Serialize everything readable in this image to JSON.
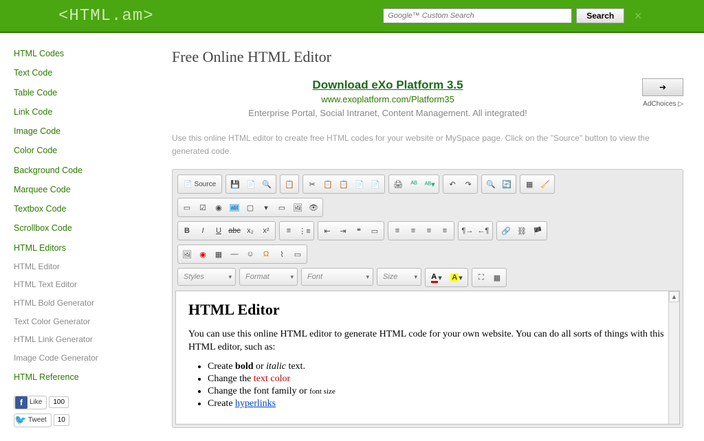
{
  "header": {
    "logo_pre": "<",
    "logo_main": "HTML",
    "logo_suf": ".am>",
    "search_placeholder": "Google™ Custom Search",
    "search_button": "Search"
  },
  "sidebar": {
    "main": [
      "HTML Codes",
      "Text Code",
      "Table Code",
      "Link Code",
      "Image Code",
      "Color Code",
      "Background Code",
      "Marquee Code",
      "Textbox Code",
      "Scrollbox Code",
      "HTML Editors"
    ],
    "sub": [
      "HTML Editor",
      "HTML Text Editor",
      "HTML Bold Generator",
      "Text Color Generator",
      "HTML Link Generator",
      "Image Code Generator"
    ],
    "ref": "HTML Reference",
    "like_label": "Like",
    "like_count": "100",
    "tweet_label": "Tweet",
    "tweet_count": "10"
  },
  "page": {
    "title": "Free Online HTML Editor",
    "ad_title": "Download eXo Platform 3.5",
    "ad_url": "www.exoplatform.com/Platform35",
    "ad_desc": "Enterprise Portal, Social Intranet, Content Management. All integrated!",
    "adchoices": "AdChoices",
    "intro": "Use this online HTML editor to create free HTML codes for your website or MySpace page. Click on the \"Source\" button to view the generated code."
  },
  "toolbar": {
    "source": "Source",
    "styles": "Styles",
    "format": "Format",
    "font": "Font",
    "size": "Size"
  },
  "content": {
    "h": "HTML Editor",
    "p1a": "You can use this online HTML editor to generate HTML code for your own website. You can do all sorts of things with this HTML editor, such as:",
    "li1a": "Create ",
    "li1b": "bold",
    "li1c": " or ",
    "li1d": "italic",
    "li1e": " text.",
    "li2a": "Change the ",
    "li2b": "text color",
    "li3a": "Change the ",
    "li3b": "font family",
    "li3c": " or ",
    "li3d": "font size",
    "li4a": "Create ",
    "li4b": "hyperlinks"
  }
}
